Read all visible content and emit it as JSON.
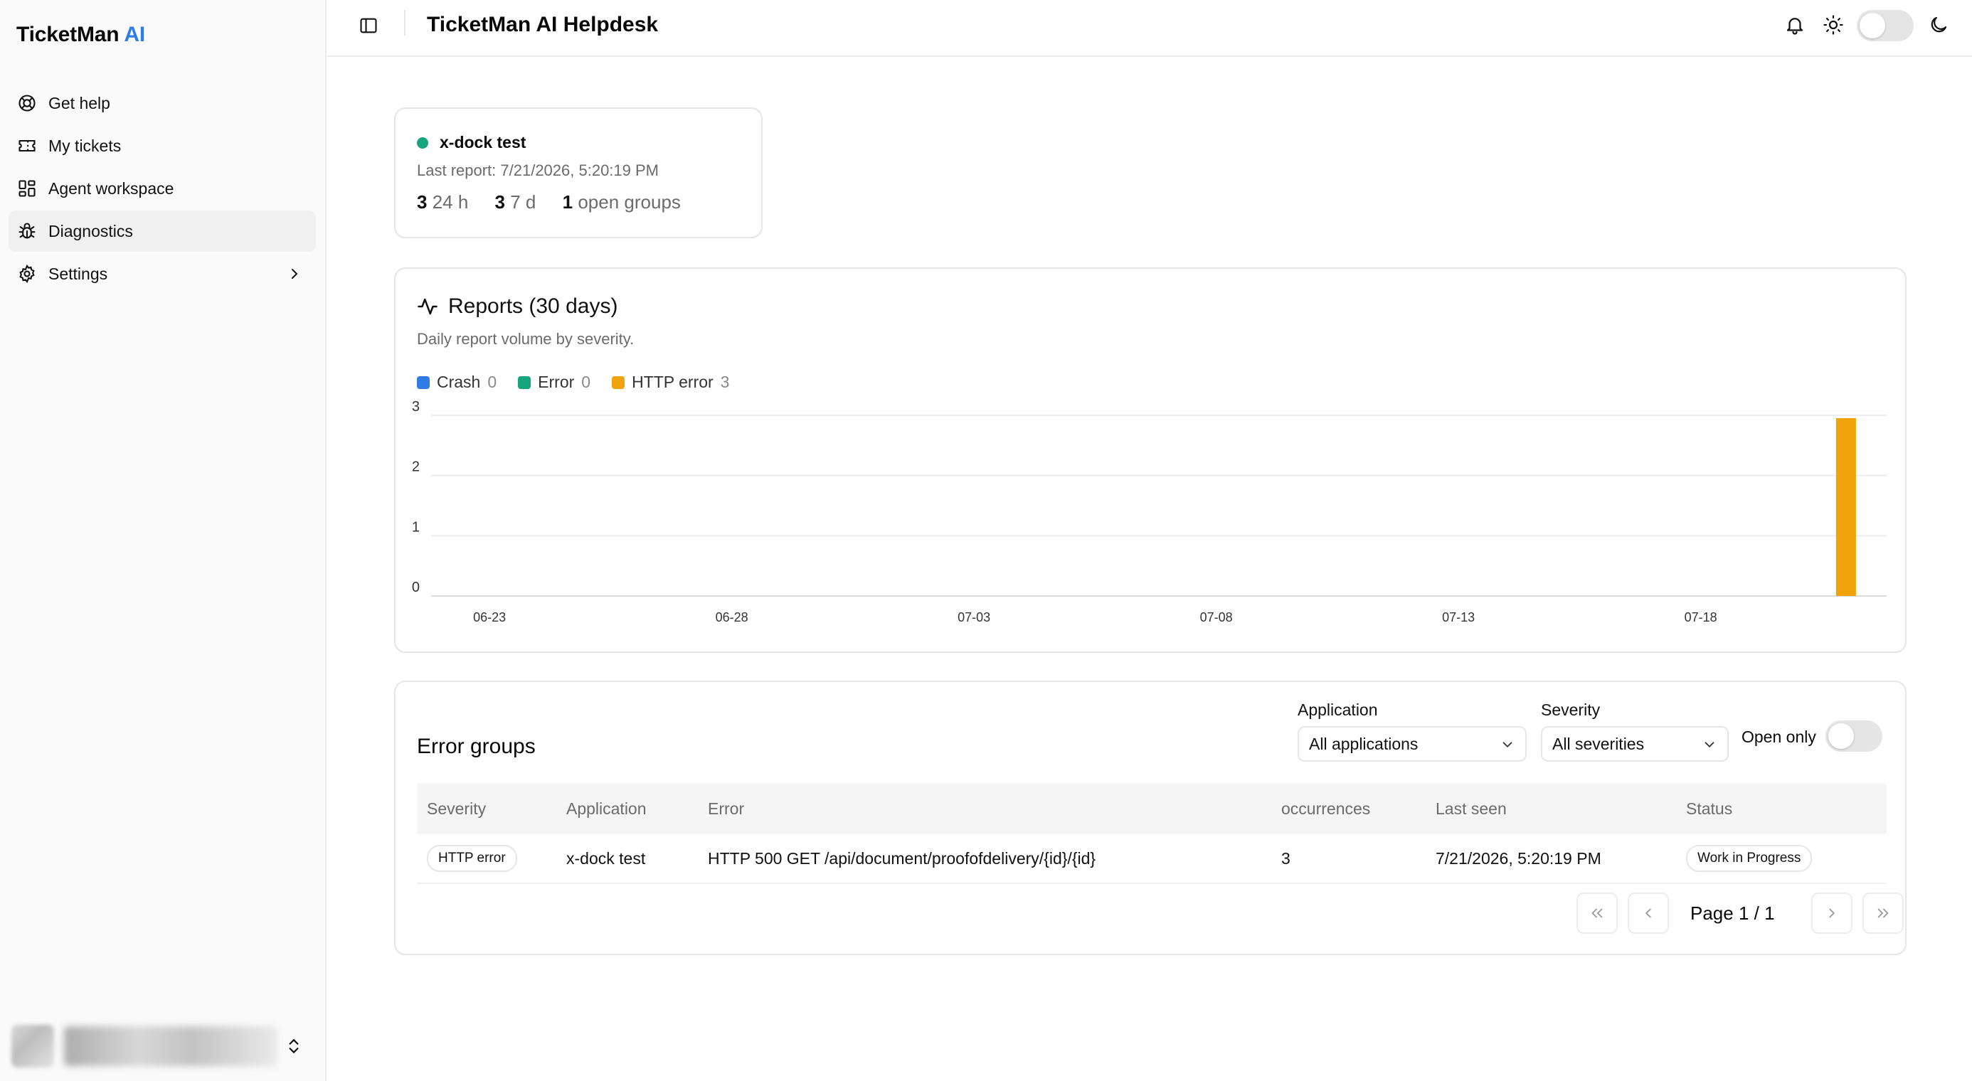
{
  "brand": {
    "name": "TicketMan",
    "suffix": "AI",
    "accent": "#2f7be8"
  },
  "sidebar": {
    "items": [
      {
        "label": "Get help",
        "icon": "lifebuoy-icon"
      },
      {
        "label": "My tickets",
        "icon": "ticket-icon"
      },
      {
        "label": "Agent workspace",
        "icon": "dashboard-icon"
      },
      {
        "label": "Diagnostics",
        "icon": "bug-icon",
        "active": true
      },
      {
        "label": "Settings",
        "icon": "gear-icon",
        "has_children": true
      }
    ]
  },
  "header": {
    "title": "TicketMan AI Helpdesk"
  },
  "app_card": {
    "name": "x-dock test",
    "status_color": "#16a57e",
    "last_report": "Last report: 7/21/2026, 5:20:19 PM",
    "stats": [
      {
        "value": "3",
        "label": "24 h"
      },
      {
        "value": "3",
        "label": "7 d"
      },
      {
        "value": "1",
        "label": "open groups"
      }
    ]
  },
  "reports": {
    "title": "Reports (30 days)",
    "subtitle": "Daily report volume by severity.",
    "legend": [
      {
        "name": "Crash",
        "count": "0",
        "color": "#2f7be8"
      },
      {
        "name": "Error",
        "count": "0",
        "color": "#16a57e"
      },
      {
        "name": "HTTP error",
        "count": "3",
        "color": "#f0a30a"
      }
    ]
  },
  "chart_data": {
    "type": "bar",
    "stacked": true,
    "x_ticks": [
      "06-23",
      "06-28",
      "07-03",
      "07-08",
      "07-13",
      "07-18"
    ],
    "y_ticks": [
      0,
      1,
      2,
      3
    ],
    "ylim": [
      0,
      3
    ],
    "x_start": "06-22",
    "num_days": 30,
    "grid": true,
    "series": [
      {
        "name": "Crash",
        "color": "#2f7be8",
        "points": []
      },
      {
        "name": "Error",
        "color": "#16a57e",
        "points": []
      },
      {
        "name": "HTTP error",
        "color": "#f0a30a",
        "points": [
          {
            "x": "07-21",
            "y": 3
          }
        ]
      }
    ]
  },
  "groups": {
    "title": "Error groups",
    "filters": {
      "application": {
        "label": "Application",
        "value": "All applications"
      },
      "severity": {
        "label": "Severity",
        "value": "All severities"
      },
      "open_only_label": "Open only"
    },
    "columns": [
      "Severity",
      "Application",
      "Error",
      "occurrences",
      "Last seen",
      "Status"
    ],
    "rows": [
      {
        "severity": "HTTP error",
        "application": "x-dock test",
        "error": "HTTP 500 GET /api/document/proofofdelivery/{id}/{id}",
        "occurrences": "3",
        "last_seen": "7/21/2026, 5:20:19 PM",
        "status": "Work in Progress"
      }
    ],
    "pager": {
      "label": "Page 1 / 1"
    }
  }
}
